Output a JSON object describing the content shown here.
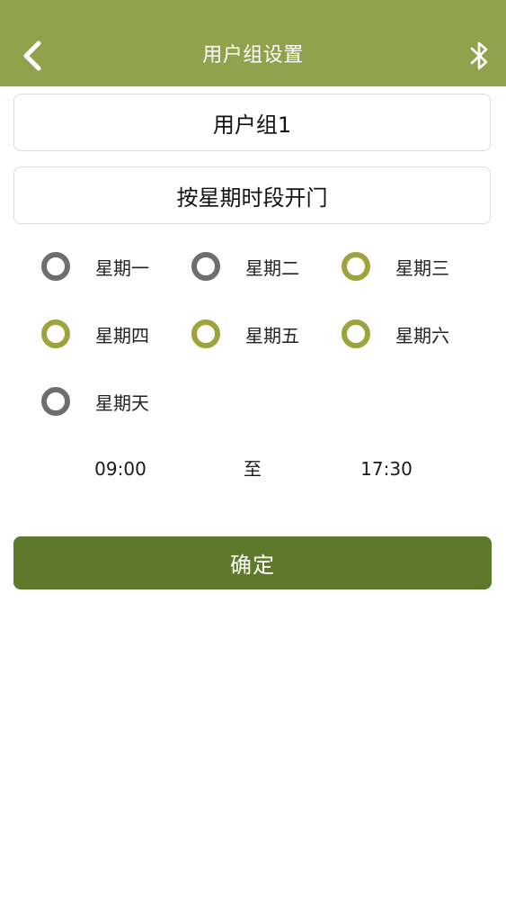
{
  "header": {
    "title": "用户组设置",
    "back_icon": "chevron-left-icon",
    "bluetooth_icon": "bluetooth-icon",
    "background_color": "#8fa24c"
  },
  "form": {
    "group_name": "用户组1",
    "access_mode": "按星期时段开门"
  },
  "days": [
    {
      "label": "星期一",
      "selected": false
    },
    {
      "label": "星期二",
      "selected": false
    },
    {
      "label": "星期三",
      "selected": true
    },
    {
      "label": "星期四",
      "selected": true
    },
    {
      "label": "星期五",
      "selected": true
    },
    {
      "label": "星期六",
      "selected": true
    },
    {
      "label": "星期天",
      "selected": false
    }
  ],
  "time_range": {
    "start": "09:00",
    "separator": "至",
    "end": "17:30"
  },
  "actions": {
    "confirm_label": "确定",
    "confirm_color": "#5c7a2a"
  },
  "colors": {
    "radio_selected": "#9ea33c",
    "radio_unselected": "#6e6e6e"
  }
}
